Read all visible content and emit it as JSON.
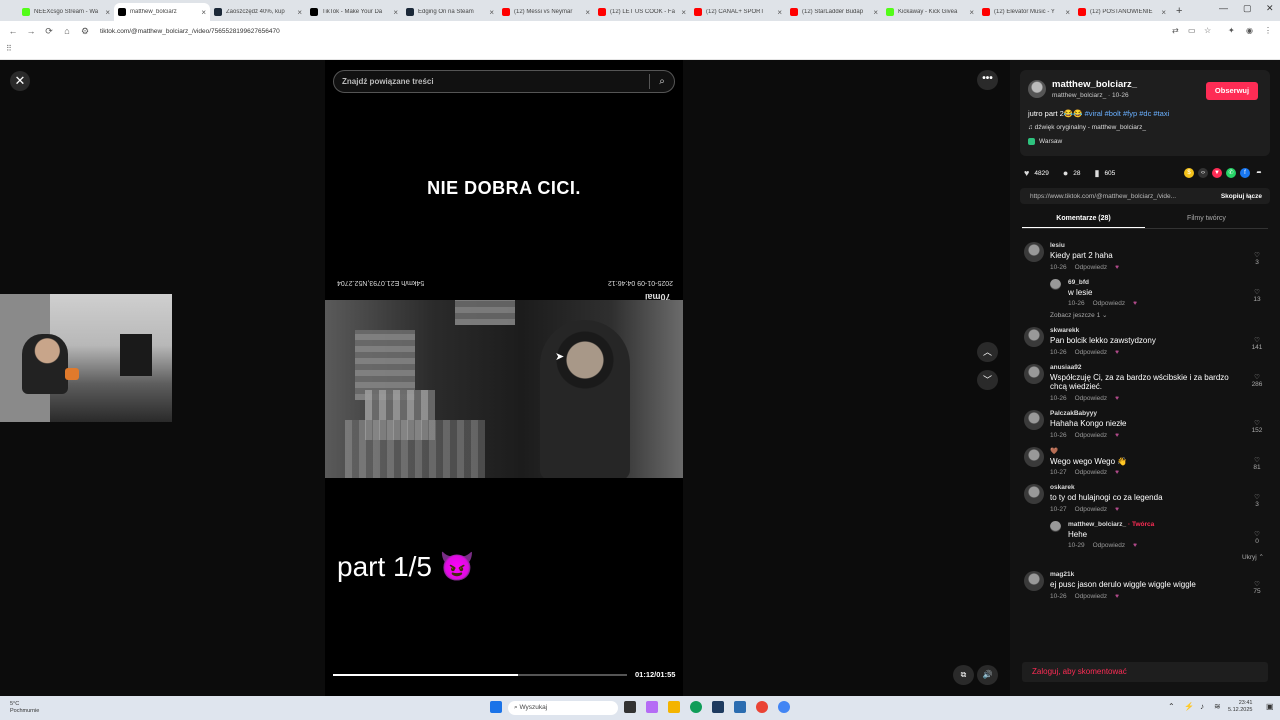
{
  "browser": {
    "tabs": [
      {
        "title": "NEEXcsgo Stream - Wa",
        "icon_color": "#53fc18"
      },
      {
        "title": "matthew_bolciarz",
        "icon_color": "#000000",
        "active": true
      },
      {
        "title": "Zaoszczędź 40%, kup",
        "icon_color": "#1b2838"
      },
      {
        "title": "TikTok - Make Your Da",
        "icon_color": "#000000"
      },
      {
        "title": "Edging On na Steam",
        "icon_color": "#1b2838"
      },
      {
        "title": "(12) Messi vs Neymar",
        "icon_color": "#ff0000"
      },
      {
        "title": "(12) LET US COOK - Fa",
        "icon_color": "#ff0000"
      },
      {
        "title": "(12) CANAL+ SPORT",
        "icon_color": "#ff0000"
      },
      {
        "title": "(12) StarLadder Budap",
        "icon_color": "#ff0000"
      },
      {
        "title": "Kickaway - Kick Givea",
        "icon_color": "#53fc18"
      },
      {
        "title": "(12) Elevator Music - Y",
        "icon_color": "#ff0000"
      },
      {
        "title": "(12) POSTANOWIENIE",
        "icon_color": "#ff0000"
      }
    ],
    "url": "tiktok.com/@matthew_bolciarz_/video/7565528199627656470"
  },
  "video": {
    "search_placeholder": "Znajdź powiązane treści",
    "caption": "NIE DOBRA CICI.",
    "cam_left": "2025-01-09 04:46:12",
    "cam_right": "54km/h E21.0793,N52.2704",
    "brand": "70mai",
    "overlay_text": "part 1/5 😈",
    "progress": 0.63,
    "time": "01:12/01:55"
  },
  "post": {
    "username": "matthew_bolciarz_",
    "subline": "matthew_bolciarz_ · 10-26",
    "follow_label": "Obserwuj",
    "desc_text": "jutro part 2😂😂",
    "hashtags": "#viral #bolt #fyp #dc #taxi",
    "sound": "♫  dźwięk oryginalny - matthew_bolciarz_",
    "location": "Warsaw",
    "likes": "4829",
    "comments": "28",
    "saves": "605",
    "link": "https://www.tiktok.com/@matthew_bolciarz_/vide...",
    "copy_label": "Skopiuj łącze",
    "tab_comments": "Komentarze (28)",
    "tab_videos": "Filmy twórcy",
    "login_prompt": "Zaloguj, aby skomentować"
  },
  "comments": [
    {
      "user": "lesiu",
      "text": "Kiedy part 2 haha",
      "date": "10-26",
      "reply": "Odpowiedz",
      "likes": "3"
    },
    {
      "user": "69_bfd",
      "text": "w lesie",
      "date": "10-26",
      "reply": "Odpowiedz",
      "likes": "13",
      "nested": true
    },
    {
      "user": "skwarekk",
      "text": "Pan bolcik lekko zawstydzony",
      "date": "10-26",
      "reply": "Odpowiedz",
      "likes": "141"
    },
    {
      "user": "anusiaa92",
      "text": "Współczuję Ci, za za bardzo wścibskie i za bardzo chcą wiedzieć.",
      "date": "10-26",
      "reply": "Odpowiedz",
      "likes": "286"
    },
    {
      "user": "PalczakBabyyy",
      "text": "Hahaha Kongo niezłe",
      "date": "10-26",
      "reply": "Odpowiedz",
      "likes": "152"
    },
    {
      "user": "🤎",
      "text": "Wego wego Wego 👋",
      "date": "10-27",
      "reply": "Odpowiedz",
      "likes": "81"
    },
    {
      "user": "oskarek",
      "text": "to ty od hulajnogi co za legenda",
      "date": "10-27",
      "reply": "Odpowiedz",
      "likes": "3"
    },
    {
      "user": "matthew_bolciarz_",
      "text": "Hehe",
      "date": "10-29",
      "reply": "Odpowiedz",
      "likes": "0",
      "nested": true,
      "creator": "· Twórca"
    },
    {
      "user": "mag21k",
      "text": "ej pusc jason derulo wiggle wiggle wiggle",
      "date": "10-26",
      "reply": "Odpowiedz",
      "likes": "75"
    }
  ],
  "more_replies": "Zobacz jeszcze 1 ⌄",
  "hide_label": "Ukryj ⌃",
  "taskbar": {
    "weather_temp": "5°C",
    "weather_desc": "Pochmurnie",
    "search": "Wyszukaj",
    "time": "23:41",
    "date": "5.12.2025"
  }
}
